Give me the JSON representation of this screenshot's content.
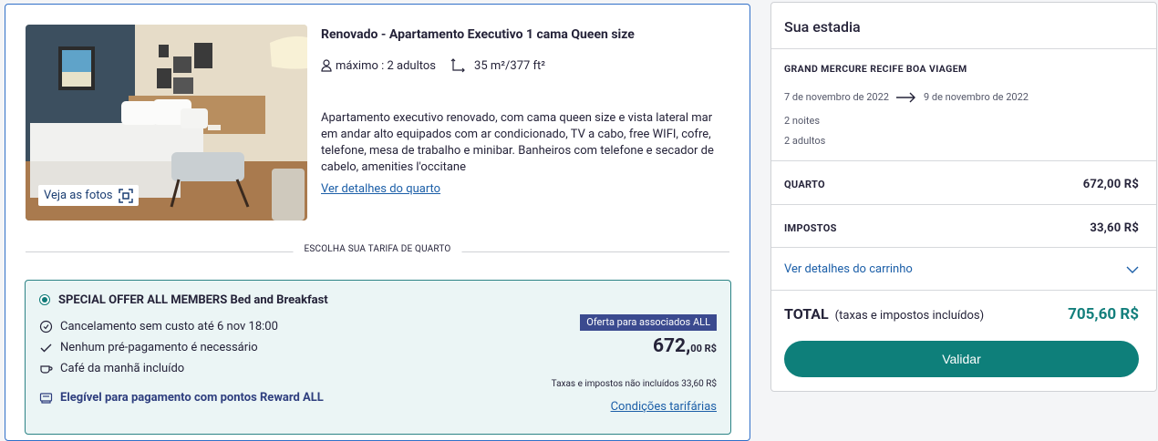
{
  "room": {
    "title": "Renovado - Apartamento Executivo 1 cama Queen size",
    "capacity": "máximo : 2 adultos",
    "area": "35 m²/377 ft²",
    "description": "Apartamento executivo renovado, com cama queen size e vista lateral mar em andar alto equipados com ar condicionado, TV a cabo, free WIFI, cofre, telefone, mesa de trabalho e minibar. Banheiros com telefone e secador de cabelo, amenities l'occitane",
    "details_link": "Ver detalhes do quarto",
    "photos_button": "Veja as fotos"
  },
  "divider_label": "ESCOLHA SUA TARIFA DE QUARTO",
  "rate": {
    "name": "SPECIAL OFFER ALL MEMBERS Bed and Breakfast",
    "cancellation": "Cancelamento sem custo até 6 nov 18:00",
    "prepayment": "Nenhum pré-pagamento é necessário",
    "breakfast": "Café da manhã incluído",
    "reward": "Elegível para pagamento com pontos Reward ALL",
    "member_badge": "Oferta para associados ALL",
    "price_main": "672,",
    "price_cents": "00 R$",
    "tax_note": "Taxas e impostos não incluídos 33,60 R$",
    "conditions_link": "Condições tarifárias"
  },
  "stay": {
    "title": "Sua estadia",
    "hotel": "GRAND MERCURE RECIFE BOA VIAGEM",
    "date_from": "7 de novembro de 2022",
    "date_to": "9 de novembro de 2022",
    "nights": "2 noites",
    "adults": "2 adultos",
    "room_label": "QUARTO",
    "room_value": "672,00 R$",
    "tax_label": "IMPOSTOS",
    "tax_value": "33,60 R$",
    "cart_link": "Ver detalhes do carrinho",
    "total_label": "TOTAL",
    "total_sub": "(taxas e impostos incluídos)",
    "total_value": "705,60 R$",
    "validate_button": "Validar"
  },
  "colors": {
    "teal": "#0e7f7a",
    "link_blue": "#1c5fa8",
    "badge_navy": "#3b4a8f",
    "rate_bg": "#ebf5f5"
  }
}
